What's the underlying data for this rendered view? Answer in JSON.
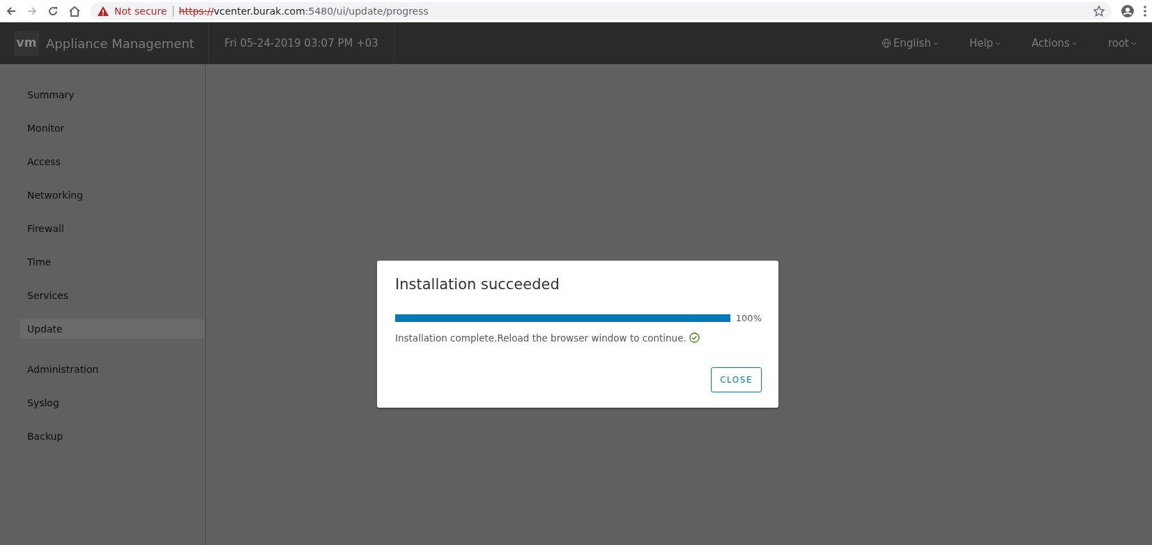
{
  "browser": {
    "security_label": "Not secure",
    "url": {
      "scheme": "https://",
      "host": "vcenter.burak.com",
      "path": ":5480/ui/update/progress"
    }
  },
  "header": {
    "logo": "vm",
    "title": "Appliance Management",
    "datetime": "Fri 05-24-2019 03:07 PM +03",
    "menus": [
      {
        "kind": "language",
        "label": "English"
      },
      {
        "kind": "menu",
        "label": "Help"
      },
      {
        "kind": "menu",
        "label": "Actions"
      },
      {
        "kind": "menu",
        "label": "root"
      }
    ]
  },
  "sidebar": {
    "items": [
      {
        "label": "Summary",
        "selected": false
      },
      {
        "label": "Monitor",
        "selected": false
      },
      {
        "label": "Access",
        "selected": false
      },
      {
        "label": "Networking",
        "selected": false
      },
      {
        "label": "Firewall",
        "selected": false
      },
      {
        "label": "Time",
        "selected": false
      },
      {
        "label": "Services",
        "selected": false
      },
      {
        "label": "Update",
        "selected": true
      },
      {
        "label": "Administration",
        "selected": false
      },
      {
        "label": "Syslog",
        "selected": false
      },
      {
        "label": "Backup",
        "selected": false
      }
    ]
  },
  "dialog": {
    "title": "Installation succeeded",
    "progress": {
      "level": 1,
      "reading": "100%"
    },
    "message": "Installation complete.Reload the browser window to continue.",
    "success": true,
    "buttons": [
      "CLOSE"
    ]
  }
}
